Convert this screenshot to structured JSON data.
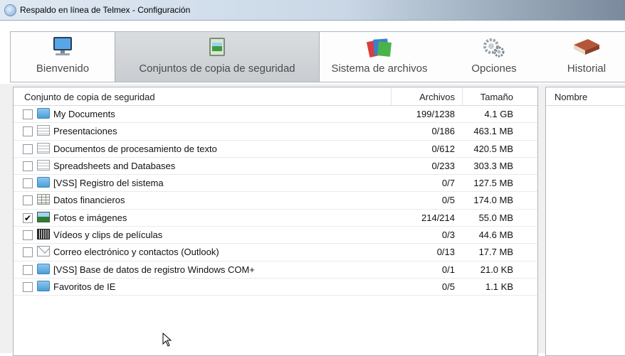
{
  "window": {
    "title": "Respaldo en línea de Telmex - Configuración"
  },
  "toolbar": {
    "tabs": [
      {
        "label": "Bienvenido",
        "icon": "monitor-icon",
        "active": false
      },
      {
        "label": "Conjuntos de copia de seguridad",
        "icon": "backup-sets-icon",
        "active": true
      },
      {
        "label": "Sistema de archivos",
        "icon": "folders-icon",
        "active": false
      },
      {
        "label": "Opciones",
        "icon": "gears-icon",
        "active": false
      },
      {
        "label": "Historial",
        "icon": "book-icon",
        "active": false
      }
    ]
  },
  "backup_list": {
    "columns": {
      "name": "Conjunto de copia de seguridad",
      "files": "Archivos",
      "size": "Tamaño"
    },
    "rows": [
      {
        "checked": false,
        "icon": "folder-icon",
        "name": "My Documents",
        "files": "199/1238",
        "size": "4.1 GB"
      },
      {
        "checked": false,
        "icon": "document-icon",
        "name": "Presentaciones",
        "files": "0/186",
        "size": "463.1 MB"
      },
      {
        "checked": false,
        "icon": "document-icon",
        "name": "Documentos de procesamiento de texto",
        "files": "0/612",
        "size": "420.5 MB"
      },
      {
        "checked": false,
        "icon": "document-icon",
        "name": "Spreadsheets and Databases",
        "files": "0/233",
        "size": "303.3 MB"
      },
      {
        "checked": false,
        "icon": "folder-icon",
        "name": "[VSS] Registro del sistema",
        "files": "0/7",
        "size": "127.5 MB"
      },
      {
        "checked": false,
        "icon": "spreadsheet-icon",
        "name": "Datos financieros",
        "files": "0/5",
        "size": "174.0 MB"
      },
      {
        "checked": true,
        "icon": "photo-icon",
        "name": "Fotos e imágenes",
        "files": "214/214",
        "size": "55.0 MB"
      },
      {
        "checked": false,
        "icon": "film-icon",
        "name": "Vídeos y clips de películas",
        "files": "0/3",
        "size": "44.6 MB"
      },
      {
        "checked": false,
        "icon": "mail-icon",
        "name": "Correo electrónico y contactos (Outlook)",
        "files": "0/13",
        "size": "17.7 MB"
      },
      {
        "checked": false,
        "icon": "folder-icon",
        "name": "[VSS] Base de datos de registro Windows COM+",
        "files": "0/1",
        "size": "21.0 KB"
      },
      {
        "checked": false,
        "icon": "folder-icon",
        "name": "Favoritos de IE",
        "files": "0/5",
        "size": "1.1 KB"
      }
    ]
  },
  "details": {
    "column_name": "Nombre"
  }
}
